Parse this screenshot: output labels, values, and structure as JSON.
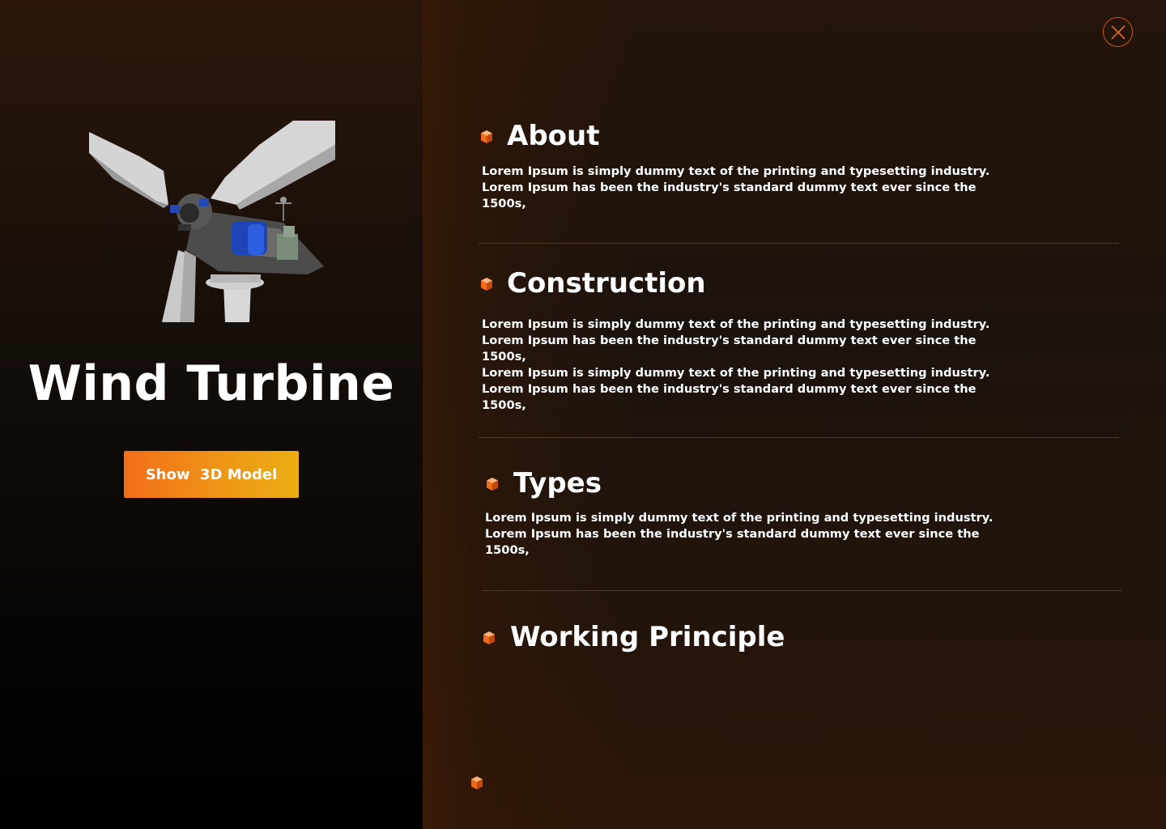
{
  "window": {
    "close_icon": "close-icon"
  },
  "hero": {
    "image_alt": "Wind turbine 3D model render",
    "title": "Wind Turbine",
    "button_label": "Show  3D Model"
  },
  "sections": [
    {
      "title": "About",
      "icon": "cube-icon",
      "body": [
        "Lorem Ipsum is simply dummy text of the printing and typesetting industry.",
        "Lorem Ipsum has been the industry's standard dummy text ever since the",
        "1500s,"
      ]
    },
    {
      "title": "Construction",
      "icon": "cube-icon",
      "body": [
        "Lorem Ipsum is simply dummy text of the printing and typesetting industry.",
        "Lorem Ipsum has been the industry's standard dummy text ever since the",
        "1500s,",
        "Lorem Ipsum is simply dummy text of the printing and typesetting industry.",
        "Lorem Ipsum has been the industry's standard dummy text ever since the",
        "1500s,"
      ]
    },
    {
      "title": "Types",
      "icon": "cube-icon",
      "body": [
        "Lorem Ipsum is simply dummy text of the printing and typesetting industry.",
        "Lorem Ipsum has been the industry's standard dummy text ever since the",
        "1500s,"
      ]
    },
    {
      "title": "Working Principle",
      "icon": "cube-icon",
      "body": []
    }
  ],
  "colors": {
    "accent": "#f36e1a",
    "accent_end": "#ebae12",
    "divider": "#4a3a2e"
  }
}
